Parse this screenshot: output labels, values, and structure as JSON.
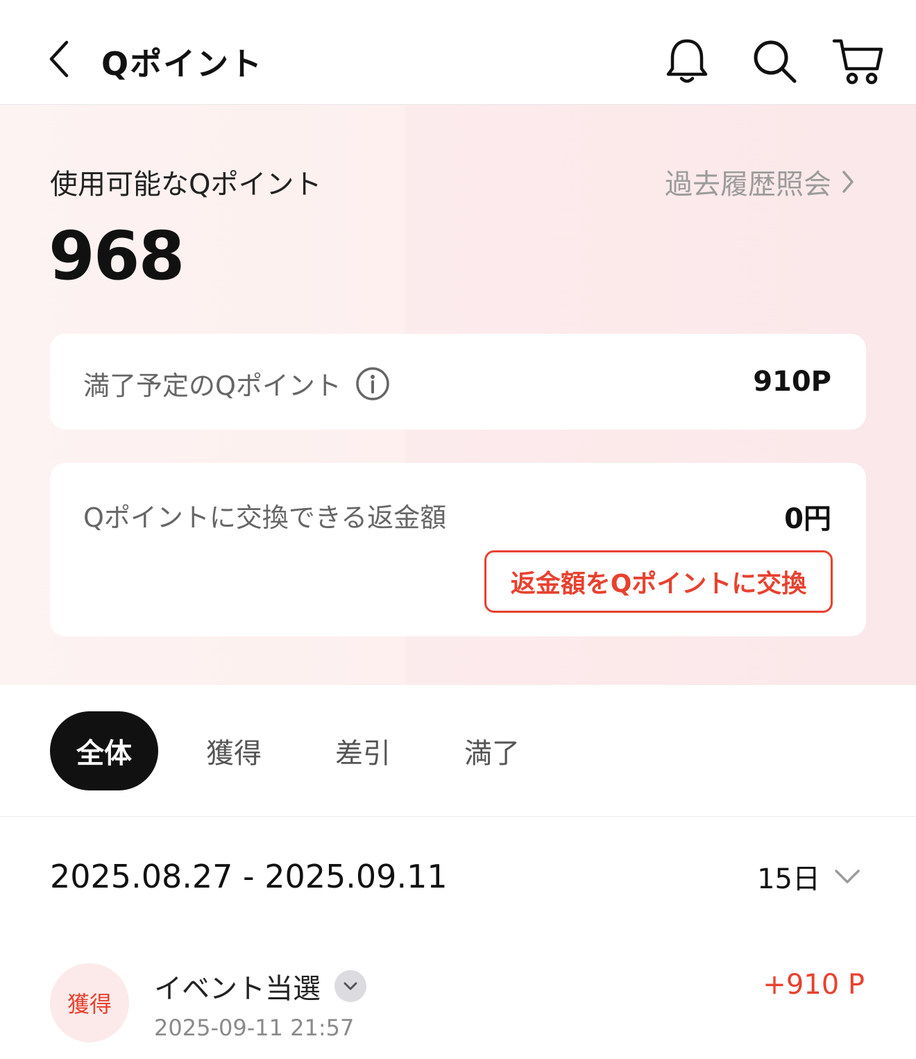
{
  "header": {
    "title": "Qポイント",
    "icons": [
      "back-chevron-icon",
      "bell-icon",
      "search-icon",
      "cart-icon"
    ]
  },
  "summary": {
    "available_label": "使用可能なQポイント",
    "history_link": "過去履歴照会",
    "available_points": "968",
    "expiring": {
      "label": "満了予定のQポイント",
      "value": "910P"
    },
    "refund": {
      "label": "Qポイントに交換できる返金額",
      "value": "0円",
      "button": "返金額をQポイントに交換"
    }
  },
  "tabs": [
    {
      "label": "全体",
      "active": true
    },
    {
      "label": "獲得",
      "active": false
    },
    {
      "label": "差引",
      "active": false
    },
    {
      "label": "満了",
      "active": false
    }
  ],
  "filter": {
    "date_range": "2025.08.27 - 2025.09.11",
    "period": "15日"
  },
  "history": [
    {
      "badge": "獲得",
      "title": "イベント当選",
      "datetime": "2025-09-11 21:57",
      "amount": "+910 P"
    }
  ],
  "colors": {
    "accent": "#e8412f",
    "badge_bg": "#fceaea",
    "active_tab_bg": "#111111"
  }
}
